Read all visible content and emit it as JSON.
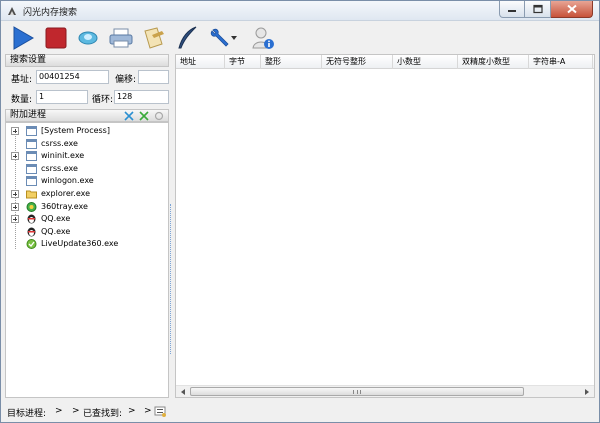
{
  "window": {
    "title": "闪光内存搜索"
  },
  "toolbar": {
    "buttons": [
      "play-icon",
      "stop-icon",
      "eye-icon",
      "printer-icon",
      "edit-document-icon",
      "quill-icon",
      "wrench-icon",
      "user-info-icon"
    ]
  },
  "search_settings": {
    "header": "搜索设置",
    "base_label": "基址:",
    "base_value": "00401254",
    "offset_label": "偏移:",
    "offset_value": "",
    "count_label": "数量:",
    "count_value": "1",
    "loop_label": "循环:",
    "loop_value": "128"
  },
  "attach": {
    "header": "附加进程",
    "processes": [
      {
        "name": "[System Process]",
        "expandable": true,
        "icon": "window-icon"
      },
      {
        "name": "csrss.exe",
        "expandable": false,
        "icon": "window-icon"
      },
      {
        "name": "wininit.exe",
        "expandable": true,
        "icon": "window-icon"
      },
      {
        "name": "csrss.exe",
        "expandable": false,
        "icon": "window-icon"
      },
      {
        "name": "winlogon.exe",
        "expandable": false,
        "icon": "window-icon"
      },
      {
        "name": "explorer.exe",
        "expandable": true,
        "icon": "folder-icon"
      },
      {
        "name": "360tray.exe",
        "expandable": true,
        "icon": "360-icon"
      },
      {
        "name": "QQ.exe",
        "expandable": true,
        "icon": "penguin-icon"
      },
      {
        "name": "QQ.exe",
        "expandable": false,
        "icon": "penguin-icon"
      },
      {
        "name": "LiveUpdate360.exe",
        "expandable": false,
        "icon": "update-icon"
      }
    ]
  },
  "table": {
    "columns": [
      "地址",
      "字节",
      "整形",
      "无符号整形",
      "小数型",
      "双精度小数型",
      "字符串-A"
    ]
  },
  "status": {
    "target_label": "目标进程:",
    "target_value": ">",
    "sep": ">",
    "found_label": "已查找到:",
    "found_value": ">",
    "found_sep": ">"
  },
  "colors": {
    "accent_blue": "#2a6fd1",
    "stop_red": "#c0272d",
    "border": "#c5c5c5"
  }
}
